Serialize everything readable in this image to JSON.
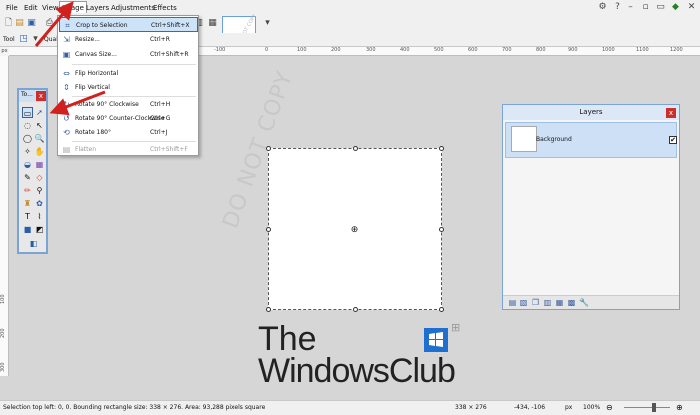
{
  "menubar": {
    "items": [
      "File",
      "Edit",
      "View",
      "Image",
      "Layers",
      "Adjustments",
      "Effects"
    ]
  },
  "toolbar": {
    "tool_label": "Tool",
    "quality_label": "Qual"
  },
  "thumbnail": {
    "watermark": "DO NOT COPY"
  },
  "ruler": {
    "corner": "px",
    "top_labels": [
      "-100",
      "0",
      "100",
      "200",
      "300",
      "400",
      "500",
      "600",
      "700",
      "800",
      "900",
      "1000",
      "1100",
      "1200"
    ],
    "left_labels": [
      "100",
      "200",
      "300"
    ]
  },
  "image_menu": {
    "items": [
      {
        "icon": "crop-icon",
        "label": "Crop to Selection",
        "shortcut": "Ctrl+Shift+X"
      },
      {
        "icon": "resize-icon",
        "label": "Resize...",
        "shortcut": "Ctrl+R"
      },
      {
        "icon": "canvas-size-icon",
        "label": "Canvas Size...",
        "shortcut": "Ctrl+Shift+R"
      },
      {
        "icon": "flip-horizontal-icon",
        "label": "Flip Horizontal",
        "shortcut": ""
      },
      {
        "icon": "flip-vertical-icon",
        "label": "Flip Vertical",
        "shortcut": ""
      },
      {
        "icon": "rotate-cw-icon",
        "label": "Rotate 90° Clockwise",
        "shortcut": "Ctrl+H"
      },
      {
        "icon": "rotate-ccw-icon",
        "label": "Rotate 90° Counter-Clockwise",
        "shortcut": "Ctrl+G"
      },
      {
        "icon": "rotate-180-icon",
        "label": "Rotate 180°",
        "shortcut": "Ctrl+J"
      },
      {
        "icon": "flatten-icon",
        "label": "Flatten",
        "shortcut": "Ctrl+Shift+F"
      }
    ]
  },
  "tools_window": {
    "title": "To...",
    "close": "x"
  },
  "canvas": {
    "watermark": "DO NOT COPY"
  },
  "layers_panel": {
    "title": "Layers",
    "close": "x",
    "layer_name": "Background",
    "checkmark": "✔"
  },
  "logo": {
    "line1": "The",
    "line2": "WindowsClub"
  },
  "statusbar": {
    "selection_info": "Selection top left: 0, 0. Bounding rectangle size: 338 × 276. Area: 93,288 pixels square",
    "size": "338 × 276",
    "cursor": "-434, -106",
    "unit": "px",
    "zoom": "100%"
  },
  "colors": {
    "accent": "#1e6fd0",
    "annotation": "#d0211e",
    "highlight": "#cde3f8"
  }
}
